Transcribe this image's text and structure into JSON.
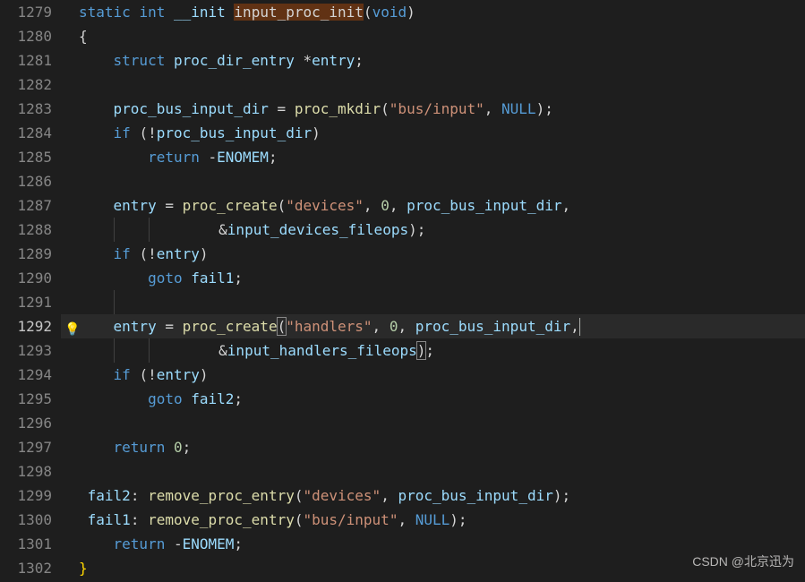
{
  "gutter": {
    "start": 1279,
    "end": 1302,
    "active": 1292
  },
  "code": {
    "l1279": {
      "kw_static": "static",
      "kw_int": "int",
      "ident_init": "__init",
      "fn_name": "input_proc_init",
      "kw_void": "void"
    },
    "l1280": {
      "brace": "{"
    },
    "l1281": {
      "kw_struct": "struct",
      "type": "proc_dir_entry",
      "star": "*",
      "ident": "entry",
      "semi": ";"
    },
    "l1283": {
      "lhs": "proc_bus_input_dir",
      "eq": " = ",
      "fn": "proc_mkdir",
      "str": "\"bus/input\"",
      "null": "NULL"
    },
    "l1284": {
      "kw_if": "if",
      "cond": "proc_bus_input_dir"
    },
    "l1285": {
      "kw_return": "return",
      "val": "ENOMEM"
    },
    "l1287": {
      "lhs": "entry",
      "eq": " = ",
      "fn": "proc_create",
      "str": "\"devices\"",
      "zero": "0",
      "arg3": "proc_bus_input_dir"
    },
    "l1288": {
      "arg": "input_devices_fileops"
    },
    "l1289": {
      "kw_if": "if",
      "cond": "entry"
    },
    "l1290": {
      "kw_goto": "goto",
      "label": "fail1"
    },
    "l1292": {
      "lhs": "entry",
      "eq": " = ",
      "fn": "proc_create",
      "str": "\"handlers\"",
      "zero": "0",
      "arg3": "proc_bus_input_dir"
    },
    "l1293": {
      "arg": "input_handlers_fileops"
    },
    "l1294": {
      "kw_if": "if",
      "cond": "entry"
    },
    "l1295": {
      "kw_goto": "goto",
      "label": "fail2"
    },
    "l1297": {
      "kw_return": "return",
      "zero": "0"
    },
    "l1299": {
      "label": "fail2",
      "fn": "remove_proc_entry",
      "str": "\"devices\"",
      "arg2": "proc_bus_input_dir"
    },
    "l1300": {
      "label": "fail1",
      "fn": "remove_proc_entry",
      "str": "\"bus/input\"",
      "null": "NULL"
    },
    "l1301": {
      "kw_return": "return",
      "val": "ENOMEM"
    },
    "l1302": {
      "brace": "}"
    }
  },
  "watermark": "CSDN @北京迅为",
  "icon": {
    "lightbulb": "💡"
  }
}
